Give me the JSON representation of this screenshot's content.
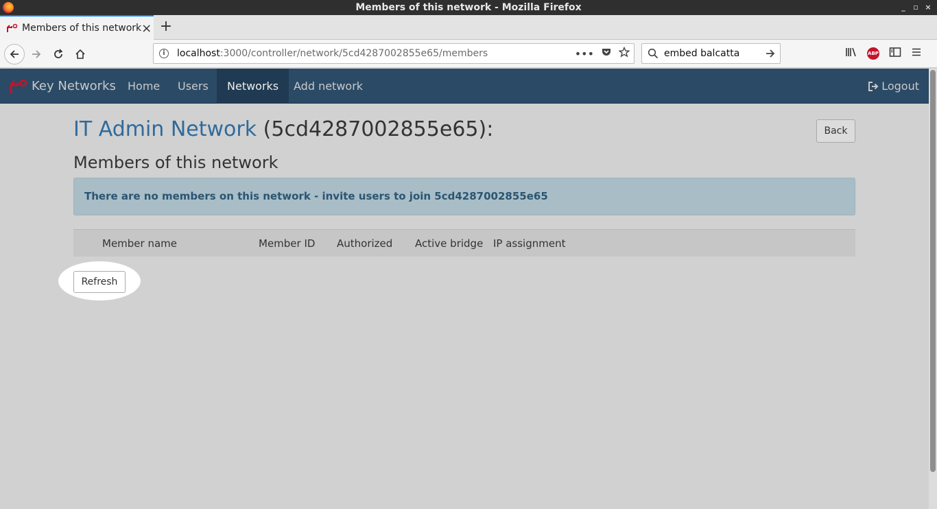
{
  "window": {
    "title": "Members of this network - Mozilla Firefox",
    "controls": [
      "_",
      "▫",
      "×"
    ]
  },
  "tabs": [
    {
      "label": "Members of this network"
    }
  ],
  "toolbar": {
    "url_host": "localhost",
    "url_rest": ":3000/controller/network/5cd4287002855e65/members",
    "search_value": "embed balcatta"
  },
  "app": {
    "brand": "Key Networks",
    "nav": [
      "Home",
      "Users",
      "Networks",
      "Add network"
    ],
    "active_nav": "Networks",
    "logout_label": "Logout"
  },
  "page": {
    "network_name": "IT Admin Network",
    "network_id_suffix": " (5cd4287002855e65):",
    "back_label": "Back",
    "subtitle": "Members of this network",
    "alert_text": "There are no members on this network - invite users to join 5cd4287002855e65",
    "table_headers": [
      "Member name",
      "Member ID",
      "Authorized",
      "Active bridge",
      "IP assignment"
    ],
    "refresh_label": "Refresh"
  },
  "colors": {
    "navbar": "#2b4a66",
    "link": "#2f6a9c",
    "alert_bg": "#a9bdc6"
  }
}
